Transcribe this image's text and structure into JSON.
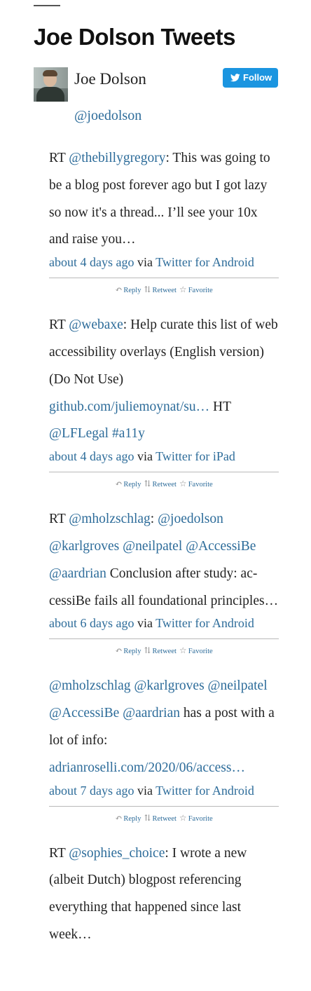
{
  "widget": {
    "title": "Joe Dolson Tweets"
  },
  "profile": {
    "name": "Joe Dolson",
    "handle": "@joedolson",
    "follow_label": "Follow"
  },
  "tweets": [
    {
      "text": [
        {
          "t": "RT "
        },
        {
          "t": "@thebillygregory",
          "link": true
        },
        {
          "t": ": This was going to be a blog post forever ago but I got lazy so now it's a thread... I’ll see your 10x and raise you…"
        }
      ],
      "time": "about 4 days ago",
      "via": " via ",
      "client": "Twitter for Android"
    },
    {
      "text": [
        {
          "t": "RT "
        },
        {
          "t": "@webaxe",
          "link": true
        },
        {
          "t": ": Help curate this list of web accessibility overlays (English version) (Do Not Use) "
        },
        {
          "t": "github.com/juliemoynat/su…",
          "link": true
        },
        {
          "t": " HT "
        },
        {
          "t": "@LFLegal",
          "link": true
        },
        {
          "t": " "
        },
        {
          "t": "#a11y",
          "link": true
        }
      ],
      "time": "about 4 days ago",
      "via": " via ",
      "client": "Twitter for iPad"
    },
    {
      "text": [
        {
          "t": "RT "
        },
        {
          "t": "@mholzschlag",
          "link": true
        },
        {
          "t": ": "
        },
        {
          "t": "@joedolson",
          "link": true
        },
        {
          "t": " "
        },
        {
          "t": "@karlgroves",
          "link": true
        },
        {
          "t": " "
        },
        {
          "t": "@neilpatel",
          "link": true
        },
        {
          "t": " "
        },
        {
          "t": "@AccessiBe",
          "link": true
        },
        {
          "t": " "
        },
        {
          "t": "@aardrian",
          "link": true
        },
        {
          "t": " Conclusion after study: ac­cessiBe fails all foundational principles…"
        }
      ],
      "time": "about 6 days ago",
      "via": " via ",
      "client": "Twitter for Android"
    },
    {
      "text": [
        {
          "t": "@mholzschlag",
          "link": true
        },
        {
          "t": " "
        },
        {
          "t": "@karlgroves",
          "link": true
        },
        {
          "t": " "
        },
        {
          "t": "@neilpatel",
          "link": true
        },
        {
          "t": " "
        },
        {
          "t": "@AccessiBe",
          "link": true
        },
        {
          "t": " "
        },
        {
          "t": "@aardrian",
          "link": true
        },
        {
          "t": " has a post with a lot of info: "
        },
        {
          "t": "adrianroselli.com/2020/06/access…",
          "link": true
        }
      ],
      "time": "about 7 days ago",
      "via": " via ",
      "client": "Twitter for Android"
    },
    {
      "text": [
        {
          "t": "RT "
        },
        {
          "t": "@sophies_choice",
          "link": true
        },
        {
          "t": ": I wrote a new (albeit Dutch) blogpost referencing everything that happened since last week…"
        }
      ],
      "time": "",
      "via": "",
      "client": ""
    }
  ],
  "actions": {
    "reply": "Reply",
    "retweet": "Retweet",
    "favorite": "Favorite"
  },
  "icons": [
    "reply-icon",
    "retweet-icon",
    "favorite-icon",
    "twitter-bird-icon"
  ],
  "colors": {
    "link": "#2d6c9a",
    "follow_button": "#1b95e0",
    "text": "#222222"
  }
}
